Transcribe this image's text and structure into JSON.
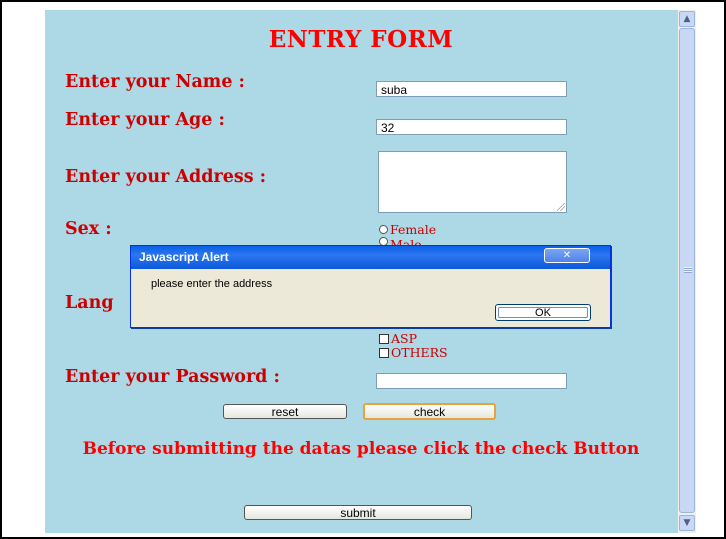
{
  "form": {
    "title": "ENTRY FORM",
    "name_label": "Enter your Name :",
    "name_value": "suba",
    "age_label": "Enter your Age :",
    "age_value": "32",
    "address_label": "Enter your Address :",
    "address_value": "",
    "sex_label": "Sex :",
    "sex_options": [
      "Female",
      "Male"
    ],
    "language_label": "Lang",
    "language_options": [
      "ASP",
      "OTHERS"
    ],
    "password_label": "Enter your Password :",
    "password_value": "",
    "reset_label": "reset",
    "check_label": "check",
    "note": "Before submitting the datas please click the check Button",
    "submit_label": "submit"
  },
  "alert": {
    "title": "Javascript Alert",
    "close_glyph": "✕",
    "message": "please enter the address",
    "ok_label": "OK"
  },
  "scrollbar": {
    "up_glyph": "▲",
    "down_glyph": "▼"
  },
  "colors": {
    "page_background": "#add8e6",
    "label_red": "#cc0000",
    "title_red": "#ff0000",
    "dialog_titlebar": "#0a5fe8",
    "dialog_body": "#ece9d8"
  }
}
